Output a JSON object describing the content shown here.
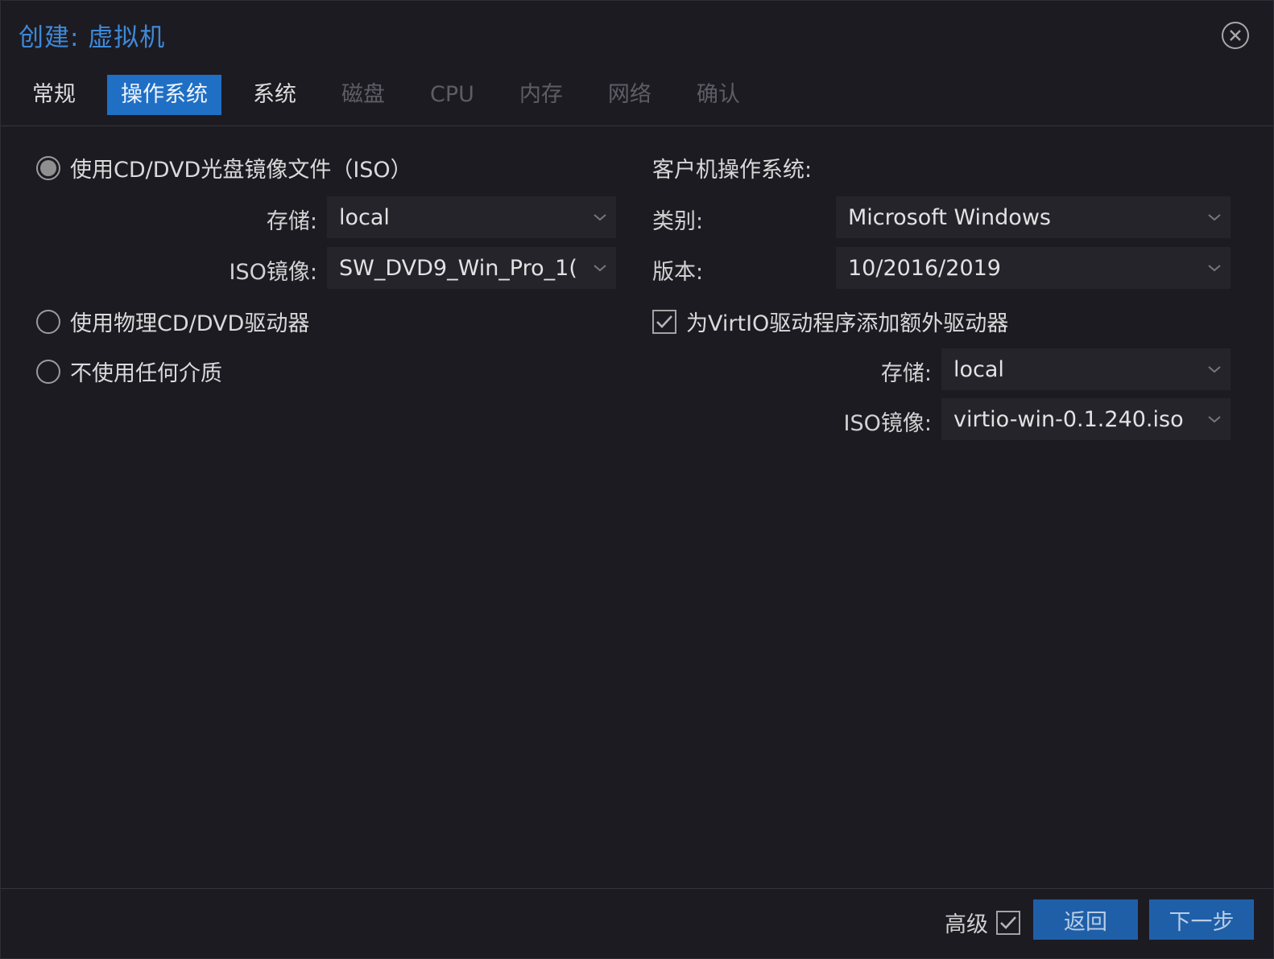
{
  "window": {
    "title": "创建: 虚拟机"
  },
  "tabs": [
    {
      "label": "常规",
      "state": "normal"
    },
    {
      "label": "操作系统",
      "state": "active"
    },
    {
      "label": "系统",
      "state": "normal"
    },
    {
      "label": "磁盘",
      "state": "disabled"
    },
    {
      "label": "CPU",
      "state": "disabled"
    },
    {
      "label": "内存",
      "state": "disabled"
    },
    {
      "label": "网络",
      "state": "disabled"
    },
    {
      "label": "确认",
      "state": "disabled"
    }
  ],
  "media": {
    "iso_option": "使用CD/DVD光盘镜像文件（ISO）",
    "storage_label": "存储:",
    "storage_value": "local",
    "iso_label": "ISO镜像:",
    "iso_value": "SW_DVD9_Win_Pro_1(",
    "physical_option": "使用物理CD/DVD驱动器",
    "none_option": "不使用任何介质"
  },
  "guest": {
    "section_title": "客户机操作系统:",
    "type_label": "类别:",
    "type_value": "Microsoft Windows",
    "version_label": "版本:",
    "version_value": "10/2016/2019",
    "virtio_label": "为VirtIO驱动程序添加额外驱动器",
    "virtio_storage_label": "存储:",
    "virtio_storage_value": "local",
    "virtio_iso_label": "ISO镜像:",
    "virtio_iso_value": "virtio-win-0.1.240.iso"
  },
  "footer": {
    "advanced_label": "高级",
    "back_label": "返回",
    "next_label": "下一步"
  },
  "colors": {
    "accent": "#1f6fc5",
    "title": "#3e89d8",
    "background": "#1c1b22"
  },
  "icons": {
    "close": "close-circle-icon",
    "dropdown": "chevron-down-icon",
    "check": "checkmark-icon"
  }
}
